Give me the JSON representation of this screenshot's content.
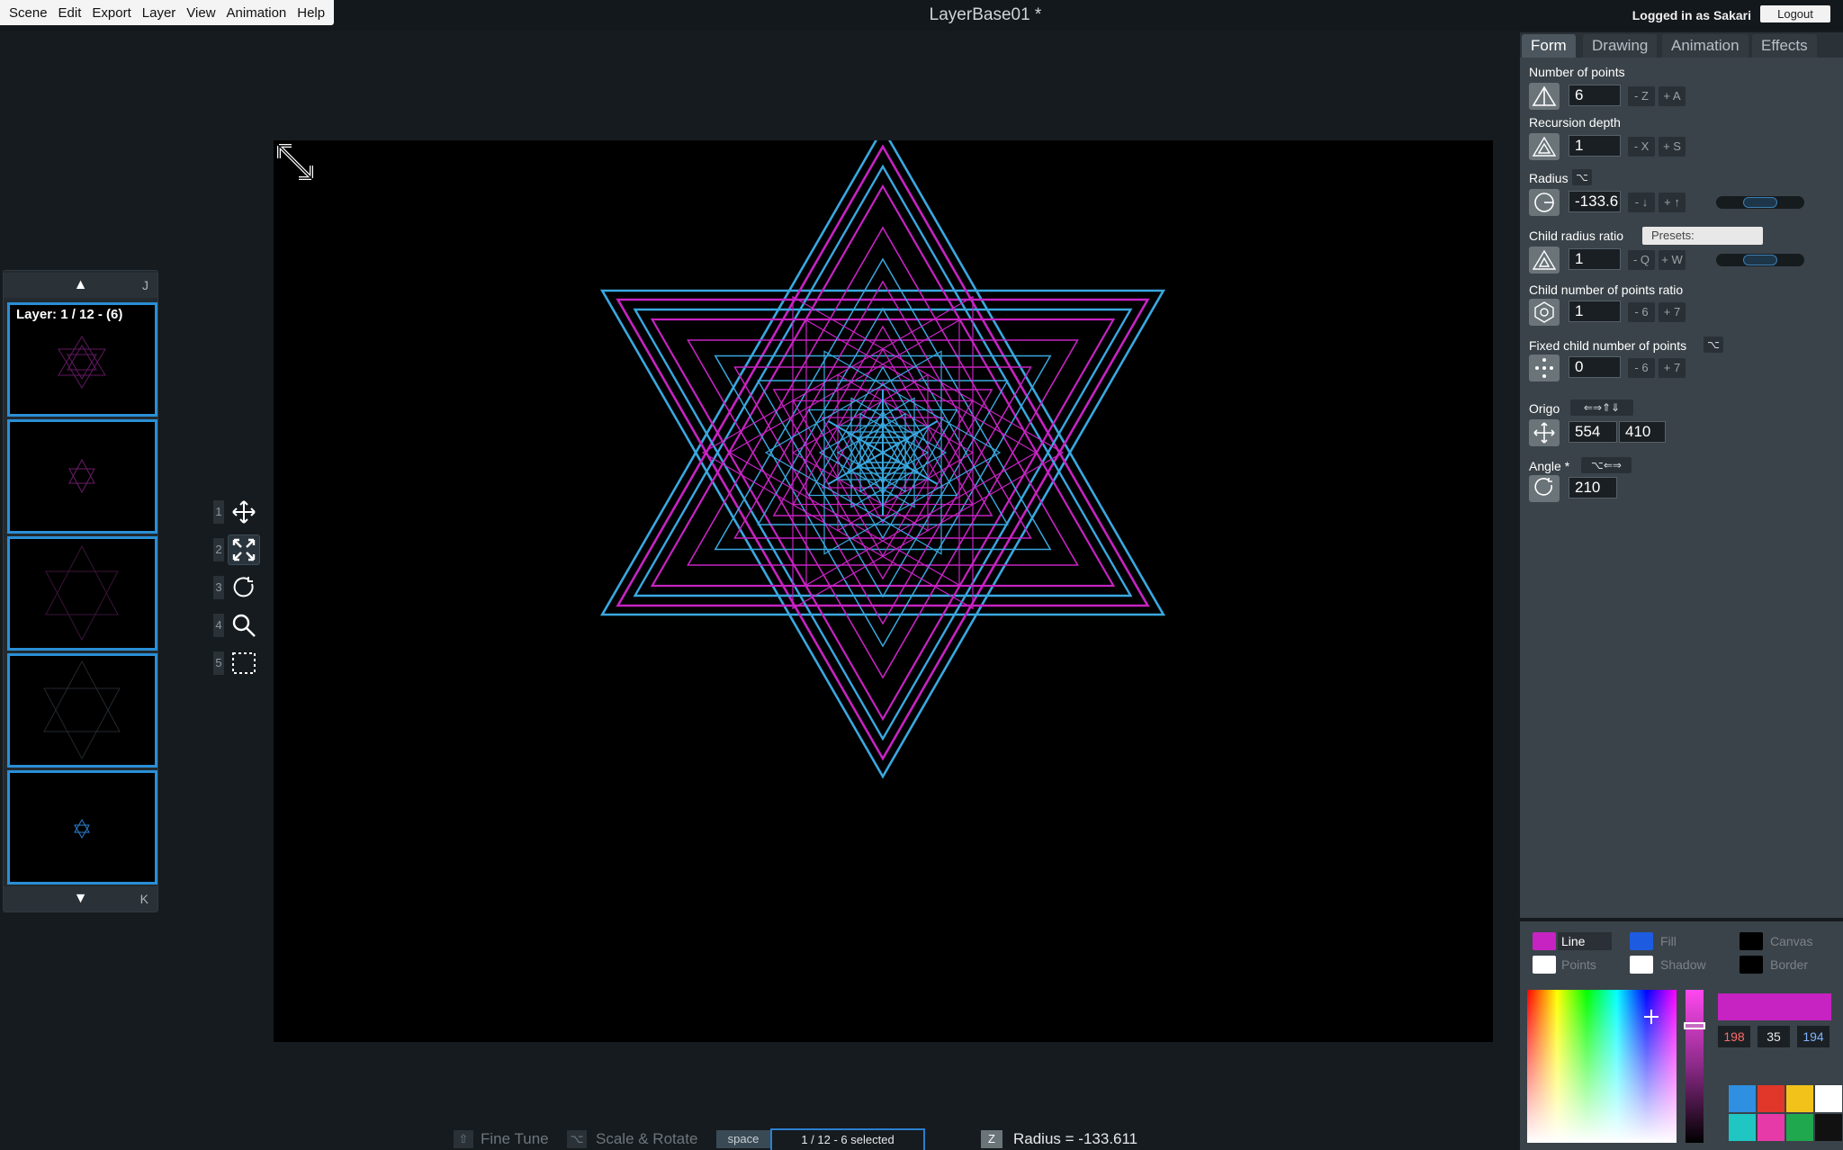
{
  "menu": [
    "Scene",
    "Edit",
    "Export",
    "Layer",
    "View",
    "Animation",
    "Help"
  ],
  "document_title": "LayerBase01 *",
  "user": {
    "login_text": "Logged in as Sakari",
    "logout_label": "Logout"
  },
  "layers": {
    "label": "Layer: 1 / 12 - (6)",
    "nav_up_key": "J",
    "nav_down_key": "K",
    "up_arrow": "▲",
    "down_arrow": "▼"
  },
  "tools": [
    {
      "num": "1",
      "icon": "move-icon"
    },
    {
      "num": "2",
      "icon": "scale-icon"
    },
    {
      "num": "3",
      "icon": "rotate-icon"
    },
    {
      "num": "4",
      "icon": "zoom-icon"
    },
    {
      "num": "5",
      "icon": "select-icon"
    }
  ],
  "tabs": [
    "Form",
    "Drawing",
    "Animation",
    "Effects"
  ],
  "form": {
    "num_points": {
      "label": "Number of points",
      "value": "6",
      "minus": "- Z",
      "plus": "+ A"
    },
    "recursion_depth": {
      "label": "Recursion depth",
      "value": "1",
      "minus": "- X",
      "plus": "+ S"
    },
    "radius": {
      "label": "Radius",
      "key": "⌥",
      "value": "-133.6",
      "minus": "- ↓",
      "plus": "+ ↑"
    },
    "child_radius_ratio": {
      "label": "Child radius ratio",
      "presets": "Presets:",
      "value": "1",
      "minus": "- Q",
      "plus": "+ W"
    },
    "child_points_ratio": {
      "label": "Child number of points ratio",
      "value": "1",
      "minus": "- 6",
      "plus": "+ 7"
    },
    "fixed_child_points": {
      "label": "Fixed child number of points",
      "key": "⌥",
      "value": "0",
      "minus": "- 6",
      "plus": "+ 7"
    },
    "origo": {
      "label": "Origo",
      "key": "⇐⇒⇑⇓",
      "x": "554",
      "y": "410"
    },
    "angle": {
      "label": "Angle *",
      "key": "⌥⇐⇒",
      "value": "210"
    }
  },
  "colors": {
    "line_label": "Line",
    "fill_label": "Fill",
    "canvas_label": "Canvas",
    "points_label": "Points",
    "shadow_label": "Shadow",
    "border_label": "Border",
    "line_color": "#c623c2",
    "fill_color": "#1d5be0",
    "r": "198",
    "g": "35",
    "b": "194"
  },
  "status": {
    "fine_tune_key": "⇧",
    "fine_tune": "Fine Tune",
    "scale_rotate_key": "⌥",
    "scale_rotate": "Scale & Rotate",
    "space_key": "space",
    "selection": "1 / 12 - 6 selected",
    "radius_key": "Z",
    "radius_text": "Radius = -133.611"
  },
  "artwork": {
    "points": 6,
    "line_color": "#c623c2",
    "accent_color": "#3aa8e0"
  }
}
